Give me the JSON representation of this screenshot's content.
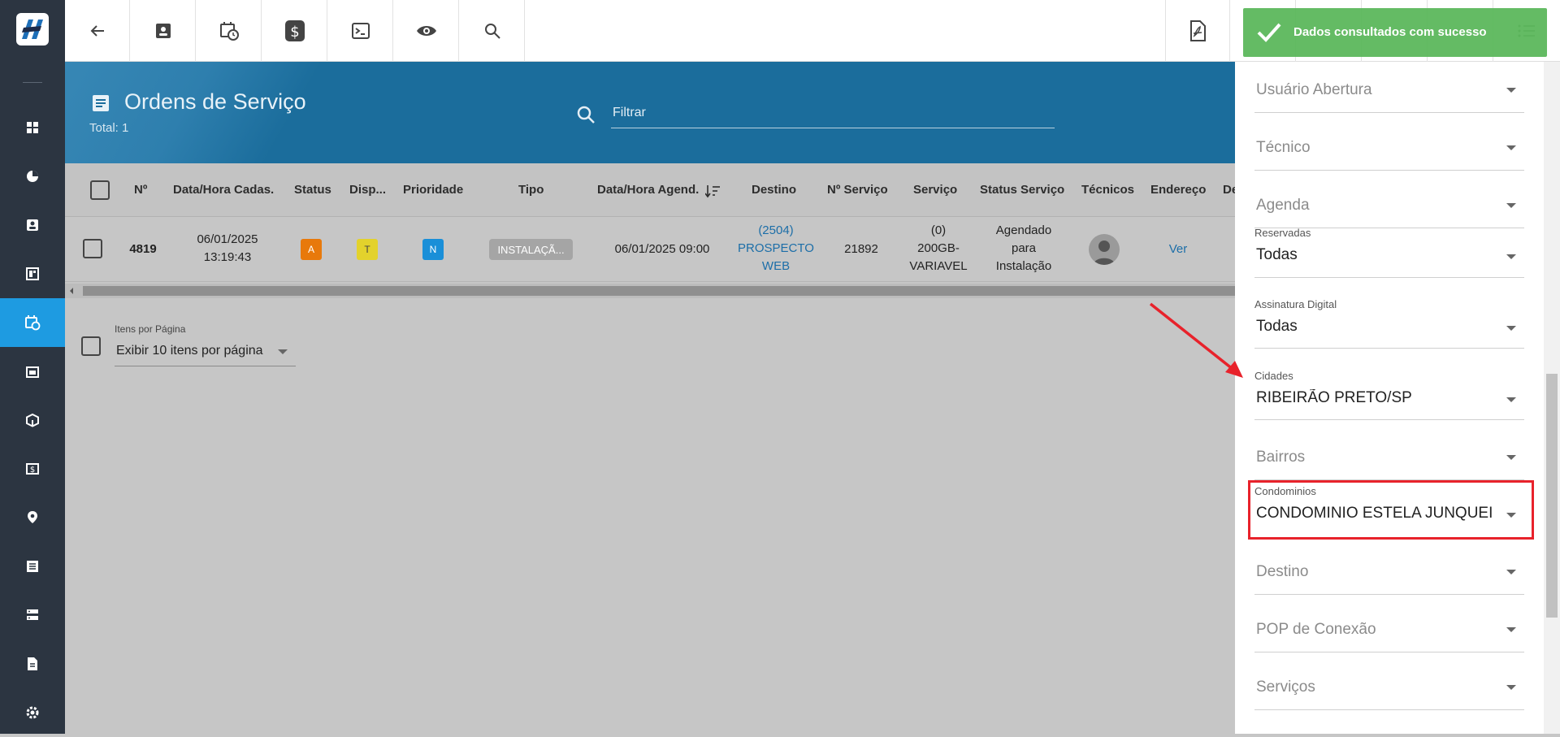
{
  "header": {
    "title": "Ordens de Serviço",
    "total": "Total: 1",
    "filter_placeholder": "Filtrar"
  },
  "table": {
    "columns": [
      "Nº",
      "Data/Hora Cadas.",
      "Status",
      "Disp...",
      "Prioridade",
      "Tipo",
      "Data/Hora Agend.",
      "Destino",
      "Nº Serviço",
      "Serviço",
      "Status Serviço",
      "Técnicos",
      "Endereço",
      "De"
    ],
    "rows": [
      {
        "numero": "4819",
        "data_cad_1": "06/01/2025",
        "data_cad_2": "13:19:43",
        "status": "A",
        "disp": "T",
        "prioridade": "N",
        "tipo": "INSTALAÇÃ...",
        "data_agend": "06/01/2025 09:00",
        "destino_1": "(2504)",
        "destino_2": "PROSPECTO",
        "destino_3": "WEB",
        "num_servico": "21892",
        "servico_1": "(0)",
        "servico_2": "200GB-",
        "servico_3": "VARIAVEL",
        "status_servico_1": "Agendado",
        "status_servico_2": "para",
        "status_servico_3": "Instalação",
        "endereco": "Ver"
      }
    ]
  },
  "pagination": {
    "label": "Itens por Página",
    "value": "Exibir 10 itens por página"
  },
  "filters": {
    "usuario_abertura": "Usuário Abertura",
    "tecnico": "Técnico",
    "agenda": "Agenda",
    "reservadas_label": "Reservadas",
    "reservadas_value": "Todas",
    "assinatura_label": "Assinatura Digital",
    "assinatura_value": "Todas",
    "cidades_label": "Cidades",
    "cidades_value": "RIBEIRÃO PRETO/SP",
    "bairros": "Bairros",
    "condominios_label": "Condominios",
    "condominios_value": "CONDOMINIO ESTELA JUNQUEIRA",
    "destino": "Destino",
    "pop": "POP de Conexão",
    "servicos": "Serviços"
  },
  "toast": {
    "message": "Dados consultados com sucesso"
  },
  "colors": {
    "sidebar": "#2c3541",
    "active": "#1e9be1",
    "header": "#1b6d9c",
    "status_a": "#e8790b",
    "disp_t": "#e3d22c",
    "prio_n": "#1a8fd8",
    "toast": "#5cb85c",
    "highlight": "#e8222b"
  }
}
